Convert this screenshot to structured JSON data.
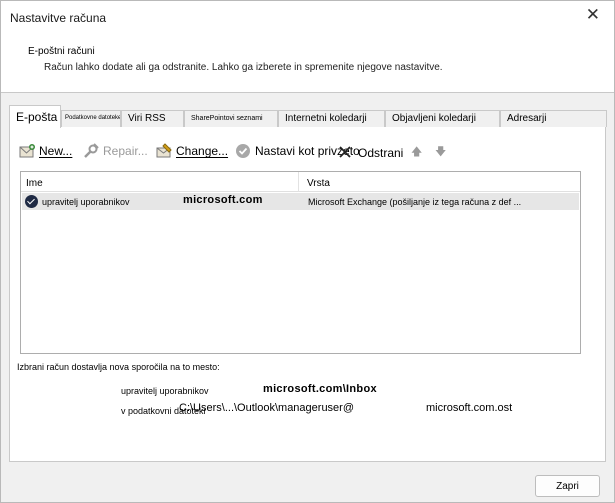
{
  "window": {
    "title": "Nastavitve računa",
    "close_glyph": "✕"
  },
  "header": {
    "section_title": "E-poštni računi",
    "description": "Račun lahko dodate ali ga odstranite. Lahko ga izberete in spremenite njegove nastavitve."
  },
  "tabs": [
    {
      "label": "E-pošta"
    },
    {
      "label": "Podatkovne datoteke"
    },
    {
      "label": "Viri RSS"
    },
    {
      "label": "SharePointovi seznami"
    },
    {
      "label": "Internetni koledarji"
    },
    {
      "label": "Objavljeni koledarji"
    },
    {
      "label": "Adresarji"
    }
  ],
  "toolbar": {
    "new_label": "New...",
    "repair_label": "Repair...",
    "change_label": "Change...",
    "default_label": "Nastavi kot privzeto",
    "remove_label": "Odstrani",
    "up_glyph": "🡅",
    "down_glyph": "🡇"
  },
  "list": {
    "headers": {
      "name": "Ime",
      "type": "Vrsta"
    },
    "rows": [
      {
        "name": "upravitelj uporabnikov",
        "domain": "microsoft.com",
        "type": "Microsoft Exchange (pošiljanje iz tega računa z def ..."
      }
    ]
  },
  "delivery": {
    "caption": "Izbrani račun dostavlja nova sporočila na to mesto:",
    "account_name": "upravitelj uporabnikov",
    "inbox": "microsoft.com\\Inbox",
    "file_label": "v podatkovni datoteki",
    "path": "C:\\Users\\...\\Outlook\\manageruser@",
    "ost": "microsoft.com.ost"
  },
  "footer": {
    "close_label": "Zapri"
  },
  "colors": {
    "selected_row": "#e6e6e6",
    "check_icon": "#1f2a44"
  }
}
